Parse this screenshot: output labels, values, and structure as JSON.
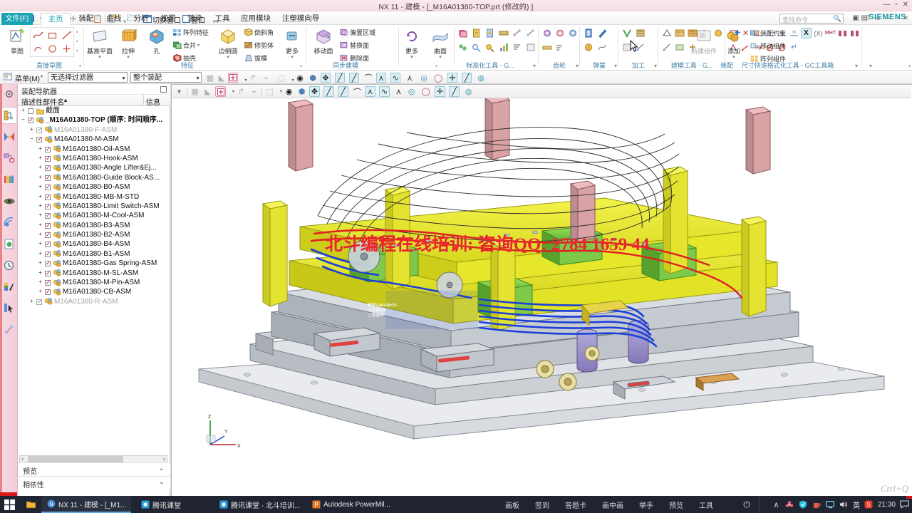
{
  "window": {
    "title": "NX 11 - 建模 - [_M16A01380-TOP.prt  (修改的)  ]",
    "brand": "NX",
    "vendor": "SIEMENS",
    "sys_buttons": "—  ▫  ✕"
  },
  "quick_access": {
    "items": [
      {
        "name": "save-icon",
        "glyph": "💾"
      },
      {
        "name": "undo-icon",
        "glyph": "↶"
      },
      {
        "name": "redo-icon",
        "glyph": "↷"
      },
      {
        "name": "cut-icon",
        "glyph": "✂"
      },
      {
        "name": "copy-icon",
        "glyph": "⧉"
      },
      {
        "name": "paste-icon",
        "glyph": "📋"
      },
      {
        "name": "new-icon",
        "glyph": "🗋"
      },
      {
        "name": "open-icon",
        "glyph": "🗀"
      }
    ],
    "switch_window_label": "切换窗口",
    "window_label": "窗口"
  },
  "ribbon": {
    "tabs": [
      {
        "label": "文件(F)",
        "state": "file"
      },
      {
        "label": "主页",
        "state": "active"
      },
      {
        "label": "装配",
        "state": "normal"
      },
      {
        "label": "曲线",
        "state": "normal"
      },
      {
        "label": "分析",
        "state": "normal"
      },
      {
        "label": "视图",
        "state": "normal"
      },
      {
        "label": "渲染",
        "state": "normal"
      },
      {
        "label": "工具",
        "state": "normal"
      },
      {
        "label": "应用模块",
        "state": "normal"
      },
      {
        "label": "注塑模向导",
        "state": "normal"
      }
    ],
    "search_placeholder": "查找命令",
    "groups": {
      "sketch": {
        "label": "直接草图",
        "big": {
          "label": "草图",
          "icon": "sketch-icon"
        },
        "tools": [
          "profile-icon",
          "rectangle-icon",
          "line-icon",
          "arc-icon",
          "circle-icon",
          "point-icon"
        ]
      },
      "feature": {
        "label": "特征",
        "big": [
          {
            "label": "基准平面",
            "icon": "datum-plane-icon"
          },
          {
            "label": "拉伸",
            "icon": "extrude-icon"
          },
          {
            "label": "孔",
            "icon": "hole-icon"
          },
          {
            "label": "边倒圆",
            "icon": "edge-blend-icon"
          },
          {
            "label": "更多",
            "icon": "more-icon"
          }
        ],
        "small": [
          {
            "label": "阵列特征",
            "icon": "pattern-feature-icon"
          },
          {
            "label": "合并",
            "icon": "unite-icon"
          },
          {
            "label": "抽壳",
            "icon": "shell-icon"
          },
          {
            "label": "倒斜角",
            "icon": "chamfer-icon"
          },
          {
            "label": "修剪体",
            "icon": "trim-body-icon"
          },
          {
            "label": "拔模",
            "icon": "draft-icon"
          }
        ]
      },
      "synchronous": {
        "label": "同步建模",
        "big": [
          {
            "label": "移动面",
            "icon": "move-face-icon"
          },
          {
            "label": "更多",
            "icon": "more-icon"
          }
        ],
        "small": [
          {
            "label": "偏置区域",
            "icon": "offset-region-icon"
          },
          {
            "label": "替换面",
            "icon": "replace-face-icon"
          },
          {
            "label": "删除面",
            "icon": "delete-face-icon"
          }
        ]
      },
      "surface": {
        "label": "曲面",
        "big": [
          {
            "label": "曲面",
            "icon": "surface-icon"
          }
        ]
      },
      "gc_standard": {
        "label": "标准化工具 - G..."
      },
      "gear": {
        "label": "齿轮"
      },
      "spring": {
        "label": "弹簧"
      },
      "machining": {
        "label": "加工"
      },
      "modeling_tools": {
        "label": "建模工具 - G..."
      },
      "dimension_fmt": {
        "label": "尺寸快速格式化工具 - GC工具箱"
      },
      "assembly": {
        "label": "装配",
        "big": [
          {
            "label": "新建组件",
            "icon": "new-component-icon"
          },
          {
            "label": "添加",
            "icon": "add-component-icon"
          }
        ],
        "small": [
          {
            "label": "装配约束",
            "icon": "assembly-constraint-icon"
          },
          {
            "label": "移动组件",
            "icon": "move-component-icon"
          },
          {
            "label": "阵列组件",
            "icon": "pattern-component-icon"
          }
        ]
      }
    }
  },
  "menubar": {
    "menu_label": "菜单(M)",
    "filter_value": "无选择过滤器",
    "scope_value": "整个装配"
  },
  "resource_bar": {
    "items": [
      {
        "name": "assembly-navigator-icon",
        "glyph": "⚙",
        "selected": false
      },
      {
        "name": "part-navigator-icon",
        "glyph": "🗂",
        "selected": true
      },
      {
        "name": "constraint-navigator-icon",
        "glyph": "🔗",
        "selected": false
      },
      {
        "name": "reuse-library-icon",
        "glyph": "🧩",
        "selected": false
      },
      {
        "name": "palette-icon",
        "glyph": "📚",
        "selected": false
      },
      {
        "name": "view-manager-icon",
        "glyph": "👁",
        "selected": false
      },
      {
        "name": "web-browser-icon",
        "glyph": "🌐",
        "selected": false
      },
      {
        "name": "history-doc-icon",
        "glyph": "📄",
        "selected": false
      },
      {
        "name": "history-clock-icon",
        "glyph": "🕐",
        "selected": false
      },
      {
        "name": "render-style-icon",
        "glyph": "🎨",
        "selected": false
      },
      {
        "name": "selection-icon",
        "glyph": "🖱",
        "selected": false
      },
      {
        "name": "process-icon",
        "glyph": "⚗",
        "selected": false
      }
    ]
  },
  "navigator": {
    "panel_title": "装配导航器",
    "col_name": "描述性部件名",
    "col_info": "信息",
    "sort_arrow": "▲",
    "tree": [
      {
        "indent": 0,
        "expander": "+",
        "check": "none",
        "icon": "section-icon",
        "label": "截面",
        "dim": false,
        "bold": false
      },
      {
        "indent": 0,
        "expander": "−",
        "check": "on",
        "icon": "assembly-icon",
        "label": "_M16A01380-TOP  (顺序:  时间顺序...",
        "dim": false,
        "bold": true
      },
      {
        "indent": 1,
        "expander": "+",
        "check": "gray",
        "icon": "assembly-icon",
        "label": "M16A01380-F-ASM",
        "dim": true,
        "bold": false
      },
      {
        "indent": 1,
        "expander": "−",
        "check": "on",
        "icon": "assembly-icon",
        "label": "M16A01380-M-ASM",
        "dim": false,
        "bold": false
      },
      {
        "indent": 2,
        "expander": "+",
        "check": "on",
        "icon": "assembly-icon",
        "label": "M16A01380-Oil-ASM",
        "dim": false,
        "bold": false
      },
      {
        "indent": 2,
        "expander": "+",
        "check": "on",
        "icon": "assembly-icon",
        "label": "M16A01380-Hook-ASM",
        "dim": false,
        "bold": false
      },
      {
        "indent": 2,
        "expander": "+",
        "check": "on",
        "icon": "assembly-icon",
        "label": "M16A01380-Angle Lifter&Ej...",
        "dim": false,
        "bold": false
      },
      {
        "indent": 2,
        "expander": "+",
        "check": "on",
        "icon": "assembly-icon",
        "label": "M16A01380-Guide Block-AS...",
        "dim": false,
        "bold": false
      },
      {
        "indent": 2,
        "expander": "+",
        "check": "on",
        "icon": "assembly-icon",
        "label": "M16A01380-B0-ASM",
        "dim": false,
        "bold": false
      },
      {
        "indent": 2,
        "expander": "+",
        "check": "on",
        "icon": "assembly-icon",
        "label": "M16A01380-MB-M-STD",
        "dim": false,
        "bold": false
      },
      {
        "indent": 2,
        "expander": "+",
        "check": "on",
        "icon": "assembly-icon",
        "label": "M16A01380-Limit Switch-ASM",
        "dim": false,
        "bold": false
      },
      {
        "indent": 2,
        "expander": "+",
        "check": "on",
        "icon": "assembly-icon",
        "label": "M16A01380-M-Cool-ASM",
        "dim": false,
        "bold": false
      },
      {
        "indent": 2,
        "expander": "+",
        "check": "on",
        "icon": "assembly-icon",
        "label": "M16A01380-B3-ASM",
        "dim": false,
        "bold": false
      },
      {
        "indent": 2,
        "expander": "+",
        "check": "on",
        "icon": "assembly-icon",
        "label": "M16A01380-B2-ASM",
        "dim": false,
        "bold": false
      },
      {
        "indent": 2,
        "expander": "+",
        "check": "on",
        "icon": "assembly-icon",
        "label": "M16A01380-B4-ASM",
        "dim": false,
        "bold": false
      },
      {
        "indent": 2,
        "expander": "+",
        "check": "on",
        "icon": "assembly-icon",
        "label": "M16A01380-B1-ASM",
        "dim": false,
        "bold": false
      },
      {
        "indent": 2,
        "expander": "+",
        "check": "on",
        "icon": "assembly-icon",
        "label": "M16A01380-Gas Spring-ASM",
        "dim": false,
        "bold": false
      },
      {
        "indent": 2,
        "expander": "+",
        "check": "on",
        "icon": "assembly-icon",
        "label": "M16A01380-M-SL-ASM",
        "dim": false,
        "bold": false
      },
      {
        "indent": 2,
        "expander": "+",
        "check": "on",
        "icon": "assembly-icon",
        "label": "M16A01380-M-Pin-ASM",
        "dim": false,
        "bold": false
      },
      {
        "indent": 2,
        "expander": "+",
        "check": "on",
        "icon": "assembly-icon",
        "label": "M16A01380-CB-ASM",
        "dim": false,
        "bold": false
      },
      {
        "indent": 1,
        "expander": "+",
        "check": "gray",
        "icon": "assembly-icon",
        "label": "M16A01380-R-ASM",
        "dim": true,
        "bold": false
      }
    ],
    "sections": [
      {
        "label": "预览",
        "chevron": "⌄"
      },
      {
        "label": "相依性",
        "chevron": "⌄"
      }
    ]
  },
  "graphics": {
    "watermark": "北斗编程在线培训: 咨询QQ: 2784 1659 44",
    "annotation": "快艺5-40+30=75\n一次深100\n二次深60",
    "triad": {
      "x": "X",
      "y": "Y",
      "z": "Z"
    },
    "corner_mark": "Ctrl+Q"
  },
  "taskbar": {
    "start_icon": "windows-logo-icon",
    "items": [
      {
        "label": "NX 11 - 建模 - [_M1...",
        "icon": "nx-icon",
        "active": true
      },
      {
        "label": "腾讯课堂",
        "icon": "tencent-class-icon",
        "active": false
      },
      {
        "label": "腾讯课堂 - 北斗培训...",
        "icon": "tencent-class-icon",
        "active": false
      },
      {
        "label": "Autodesk PowerMil...",
        "icon": "powermill-icon",
        "active": false
      }
    ],
    "class_tools": [
      "画板",
      "签到",
      "答题卡",
      "画中画",
      "举手",
      "预览",
      "工具"
    ],
    "tray": {
      "overflow": "∧",
      "icons": [
        "flower-icon",
        "shield-icon",
        "coffee-icon",
        "monitor-icon",
        "volume-icon"
      ],
      "ime": "英",
      "sogou": "S",
      "clock": "21:30",
      "notification": "notification-icon"
    }
  },
  "colors": {
    "accent": "#1ba3b5",
    "titlebar": "#f6dde3",
    "watermark": "#e8252b",
    "taskbar": "#1f2430",
    "tree_check": "#d11a1a"
  }
}
